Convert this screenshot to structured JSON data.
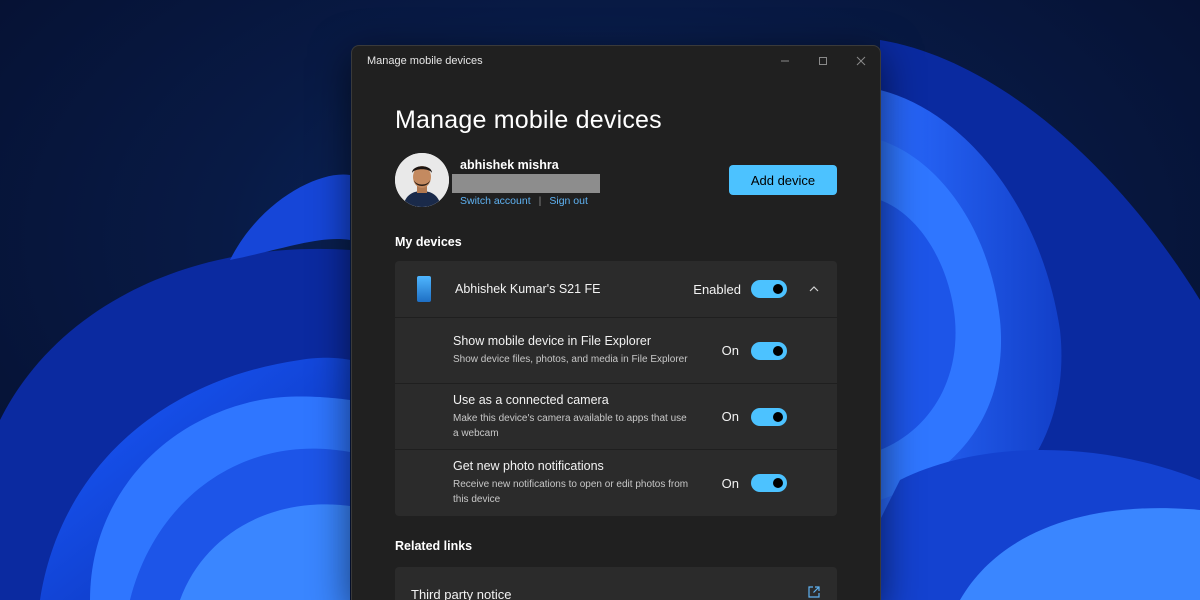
{
  "window": {
    "title": "Manage mobile devices"
  },
  "page": {
    "heading": "Manage mobile devices"
  },
  "account": {
    "name": "abhishek mishra",
    "switch_account": "Switch account",
    "separator": "|",
    "sign_out": "Sign out",
    "add_device": "Add device"
  },
  "my_devices": {
    "label": "My devices",
    "device": {
      "name": "Abhishek Kumar's S21 FE",
      "status_label": "Enabled",
      "enabled": true
    },
    "settings": [
      {
        "title": "Show mobile device in File Explorer",
        "description": "Show device files, photos, and media in File Explorer",
        "state_label": "On",
        "on": true
      },
      {
        "title": "Use as a connected camera",
        "description": "Make this device's camera available to apps that use a webcam",
        "state_label": "On",
        "on": true
      },
      {
        "title": "Get new photo notifications",
        "description": "Receive new notifications to open or edit photos from this device",
        "state_label": "On",
        "on": true
      }
    ]
  },
  "related_links": {
    "label": "Related links",
    "items": [
      {
        "label": "Third party notice"
      }
    ]
  },
  "colors": {
    "accent": "#4cc2ff",
    "window_bg": "#202020",
    "card_bg": "#2b2b2b",
    "link": "#5fb2f2"
  },
  "icons": {
    "minimize": "minimize-icon",
    "maximize": "maximize-icon",
    "close": "close-icon",
    "phone": "phone-icon",
    "chevron": "chevron-up-icon",
    "external_link": "external-link-icon"
  }
}
